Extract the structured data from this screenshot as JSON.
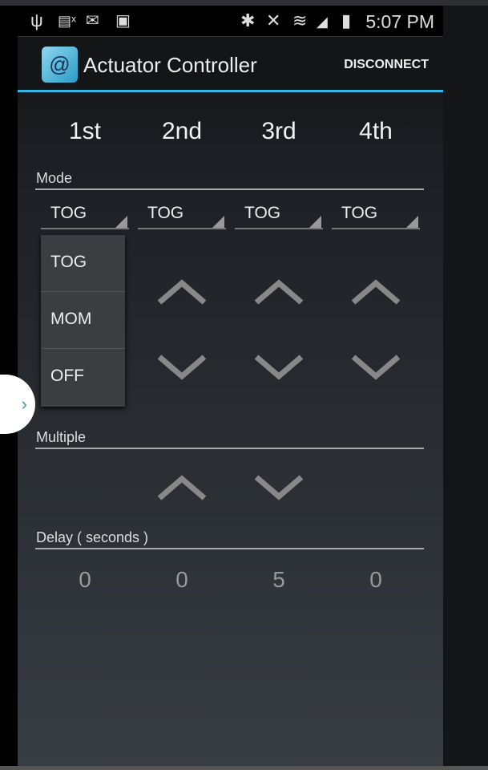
{
  "status_bar": {
    "icons": [
      "usb-icon",
      "sim-card-missing-icon",
      "gmail-icon",
      "play-store-icon",
      "bluetooth-icon",
      "mute-icon",
      "wifi-icon",
      "signal-icon",
      "battery-charging-icon"
    ],
    "time": "5:07 PM"
  },
  "action_bar": {
    "title": "Actuator Controller",
    "disconnect_label": "DISCONNECT",
    "accent": "#33b5e5"
  },
  "columns": [
    "1st",
    "2nd",
    "3rd",
    "4th"
  ],
  "mode": {
    "label": "Mode",
    "values": [
      "TOG",
      "TOG",
      "TOG",
      "TOG"
    ],
    "dropdown_options": [
      "TOG",
      "MOM",
      "OFF"
    ]
  },
  "multiple": {
    "label": "Multiple"
  },
  "delay": {
    "label": "Delay ( seconds )",
    "values": [
      "0",
      "0",
      "5",
      "0"
    ]
  }
}
